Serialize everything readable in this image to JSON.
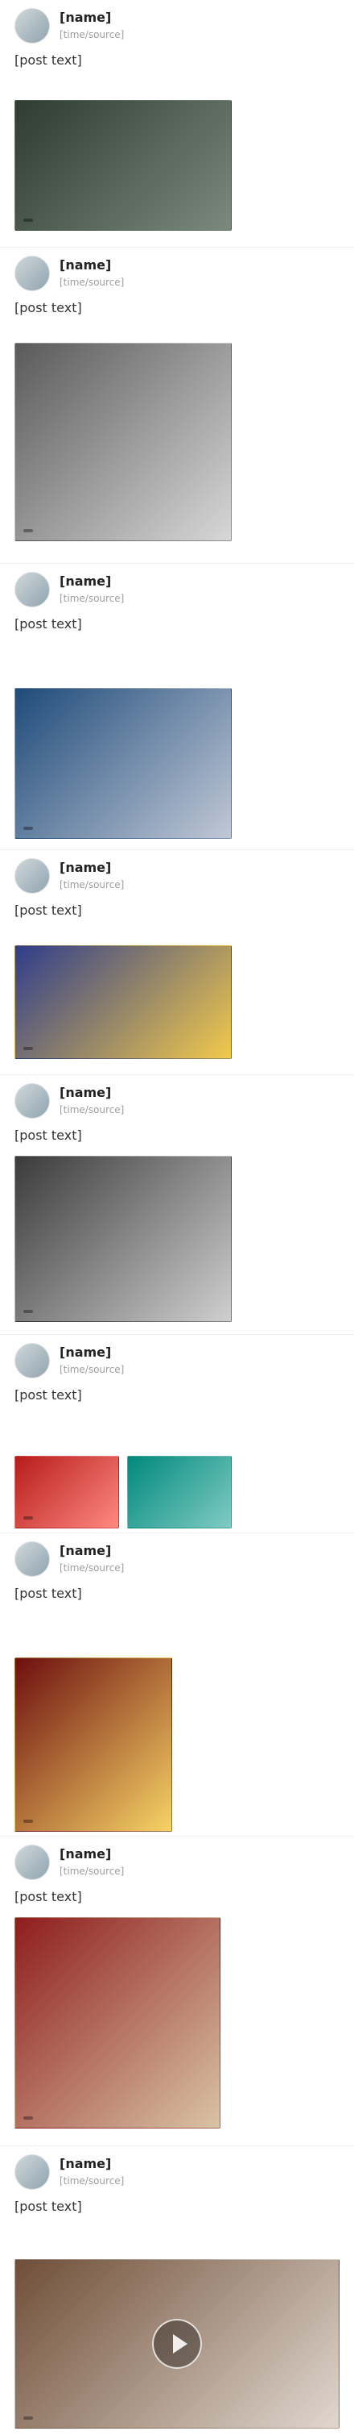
{
  "posts": [
    {
      "name": "[name]",
      "meta": "[time/source]",
      "text": "[post text]",
      "media_caption": ""
    },
    {
      "name": "[name]",
      "meta": "[time/source]",
      "text": "[post text]",
      "media_caption": ""
    },
    {
      "name": "[name]",
      "meta": "[time/source]",
      "text": "[post text]",
      "media_caption": ""
    },
    {
      "name": "[name]",
      "meta": "[time/source]",
      "text": "[post text]",
      "media_caption": ""
    },
    {
      "name": "[name]",
      "meta": "[time/source]",
      "text": "[post text]",
      "media_caption": ""
    },
    {
      "name": "[name]",
      "meta": "[time/source]",
      "text": "[post text]",
      "media_caption": ""
    },
    {
      "name": "[name]",
      "meta": "[time/source]",
      "text": "[post text]",
      "media_caption": ""
    },
    {
      "name": "[name]",
      "meta": "[time/source]",
      "text": "[post text]",
      "media_caption": ""
    },
    {
      "name": "[name]",
      "meta": "[time/source]",
      "text": "[post text]",
      "media_caption": ""
    }
  ],
  "colors": {
    "background": "#ffffff",
    "text": "#333333",
    "meta": "#9e9e9e",
    "divider": "#eeeeee"
  },
  "icons": {
    "avatar": "avatar",
    "play": "play-icon"
  }
}
